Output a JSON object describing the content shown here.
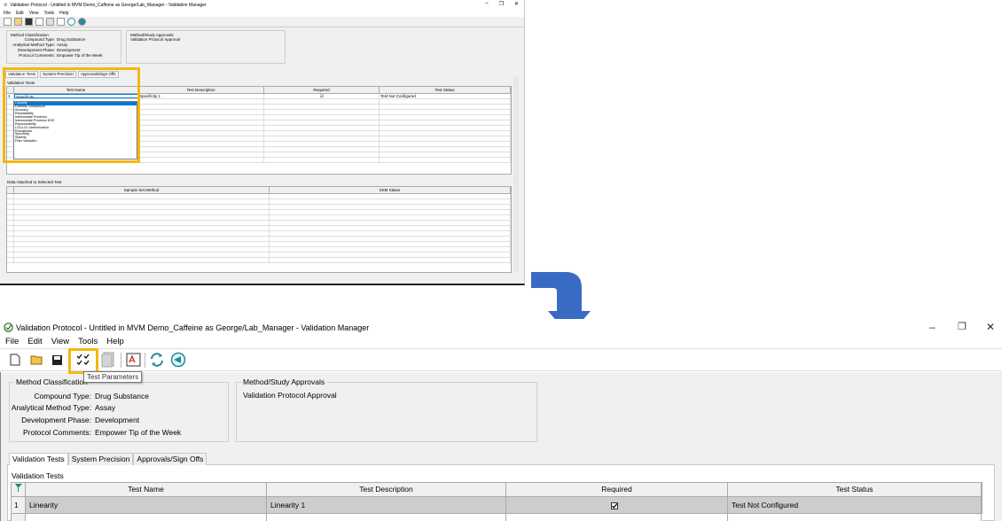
{
  "top": {
    "title": "Validation Protocol - Untitled in MVM Demo_Caffeine as George/Lab_Manager - Validation Manager",
    "menus": [
      "File",
      "Edit",
      "View",
      "Tools",
      "Help"
    ],
    "method_classification_label": "Method Classification",
    "fields": [
      {
        "k": "Compound Type:",
        "v": "Drug Substance"
      },
      {
        "k": "Analytical Method Type:",
        "v": "Assay"
      },
      {
        "k": "Development Phase:",
        "v": "Development"
      },
      {
        "k": "Protocol Comments:",
        "v": "Empower Tip of the Week"
      }
    ],
    "approvals_label": "Method/Study Approvals",
    "approval_item": "Validation Protocol Approval",
    "tabs": [
      "Validation Tests",
      "System Precision",
      "Approvals/Sign Offs"
    ],
    "validation_tests_label": "Validation Tests",
    "grid_headers": [
      "Test Name",
      "Test Description",
      "Required",
      "Test Status"
    ],
    "row": {
      "num": "1",
      "name": "Specificity",
      "desc": "Specificity 1",
      "status": "Test Not Configured"
    },
    "dropdown": [
      "Linearity",
      "Linearity Comparison",
      "Accuracy",
      "Repeatability",
      "Intermediate Precision",
      "Intermediate Precision DOE",
      "Reproducibility",
      "LOL/LOL Determination",
      "Robustness",
      "Specificity",
      "Stability",
      "Filter Validation"
    ],
    "data_label": "Data Attached to Selected Test",
    "data_headers": [
      "Sample Set Method",
      "SSM Status"
    ]
  },
  "bottom": {
    "title": "Validation Protocol - Untitled in MVM Demo_Caffeine as George/Lab_Manager - Validation Manager",
    "menus": [
      "File",
      "Edit",
      "View",
      "Tools",
      "Help"
    ],
    "tooltip": "Test Parameters",
    "method_classification_label": "Method Classification",
    "fields": [
      {
        "k": "Compound Type:",
        "v": "Drug Substance"
      },
      {
        "k": "Analytical Method Type:",
        "v": "Assay"
      },
      {
        "k": "Development Phase:",
        "v": "Development"
      },
      {
        "k": "Protocol Comments:",
        "v": "Empower Tip of the Week"
      }
    ],
    "approvals_label": "Method/Study Approvals",
    "approval_item": "Validation Protocol Approval",
    "tabs": [
      "Validation Tests",
      "System Precision",
      "Approvals/Sign Offs"
    ],
    "validation_tests_label": "Validation Tests",
    "grid_headers": [
      "Test Name",
      "Test Description",
      "Required",
      "Test Status"
    ],
    "row": {
      "num": "1",
      "name": "Linearity",
      "desc": "Linearity 1",
      "status": "Test Not Configured"
    }
  },
  "colors": {
    "highlight": "#f5b70f",
    "arrow": "#3a6bc4",
    "selection": "#0078d7"
  }
}
